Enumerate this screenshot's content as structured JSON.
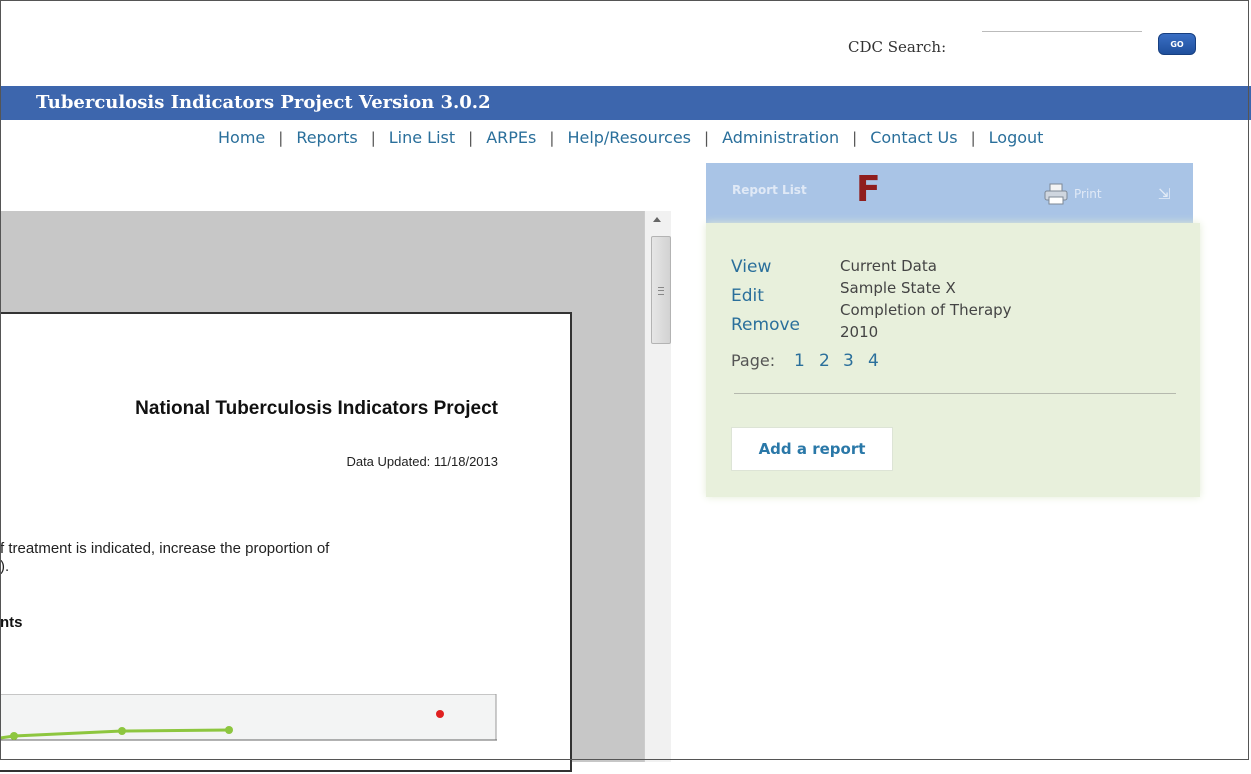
{
  "search": {
    "label": "CDC Search:",
    "button_label": "GO",
    "value": ""
  },
  "banner": {
    "title": "Tuberculosis Indicators Project Version 3.0.2"
  },
  "nav": {
    "items": [
      "Home",
      "Reports",
      "Line List",
      "ARPEs",
      "Help/Resources",
      "Administration",
      "Contact Us",
      "Logout"
    ],
    "separator": "|"
  },
  "panel": {
    "header_title": "Report List",
    "letter": "F",
    "print_label": "Print",
    "actions": [
      "View",
      "Edit",
      "Remove"
    ],
    "details": [
      "Current Data",
      "Sample State X",
      "Completion of Therapy",
      "2010"
    ],
    "page_label": "Page:",
    "pages": [
      "1",
      "2",
      "3",
      "4"
    ],
    "add_button": "Add a report"
  },
  "document": {
    "title": "National Tuberculosis Indicators Project",
    "updated": "Data Updated: 11/18/2013",
    "text_line1": "f treatment is indicated, increase the proportion of",
    "text_line2": ").",
    "heading": "nts",
    "colors": {
      "series": "#8dc63f",
      "target": "#e02020"
    }
  }
}
